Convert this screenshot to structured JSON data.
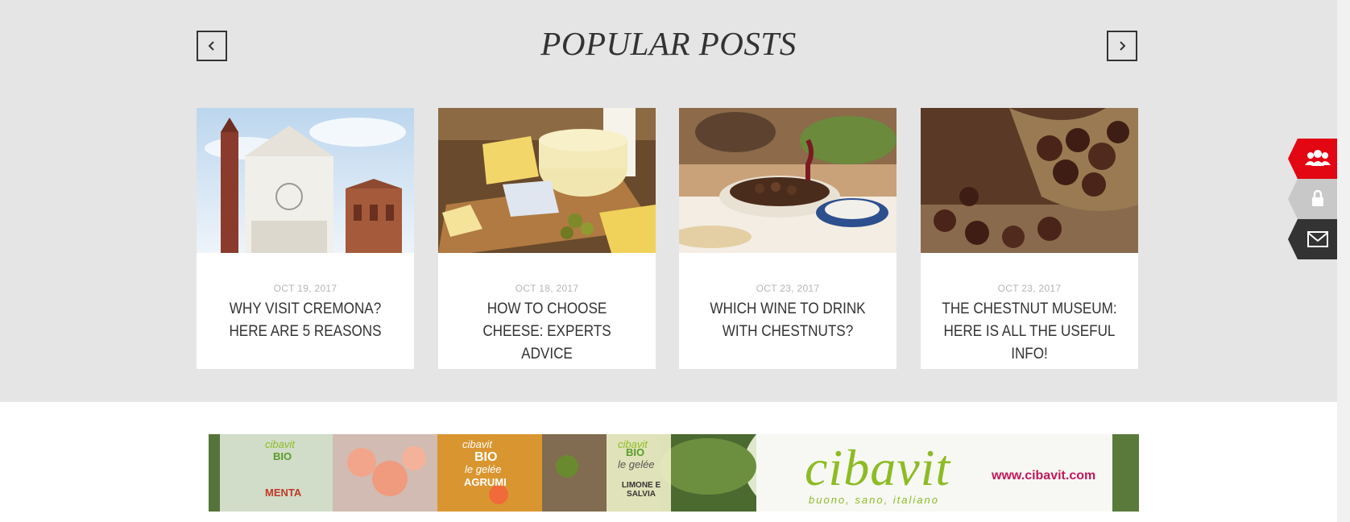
{
  "popular": {
    "title": "POPULAR POSTS",
    "posts": [
      {
        "date": "OCT 19, 2017",
        "title": "WHY VISIT CREMONA? HERE ARE 5 REASONS"
      },
      {
        "date": "OCT 18, 2017",
        "title": "HOW TO CHOOSE CHEESE: EXPERTS ADVICE"
      },
      {
        "date": "OCT 23, 2017",
        "title": "WHICH WINE TO DRINK WITH CHESTNUTS?"
      },
      {
        "date": "OCT 23, 2017",
        "title": "THE CHESTNUT MUSEUM: HERE IS ALL THE USEFUL INFO!"
      }
    ]
  },
  "side_tabs": [
    {
      "icon": "users-icon",
      "color": "#e30613"
    },
    {
      "icon": "lock-icon",
      "color": "#c8c8c8"
    },
    {
      "icon": "envelope-icon",
      "color": "#333333"
    }
  ],
  "banner": {
    "brand": "cibavit",
    "tagline": "buono, sano, italiano",
    "url": "www.cibavit.com",
    "jars": [
      {
        "brand": "cibavit",
        "type": "BIO",
        "label": "MENTA"
      },
      {
        "brand": "cibavit",
        "type": "BIO",
        "sub": "le gelée",
        "label": "AGRUMI"
      },
      {
        "brand": "cibavit",
        "type": "BIO",
        "sub": "le gelée",
        "label": "LIMONE E SALVIA"
      }
    ]
  },
  "colors": {
    "section_bg": "#e5e5e5",
    "accent_red": "#e30613",
    "brand_green": "#8dbb25",
    "brand_pink": "#c2185b"
  }
}
